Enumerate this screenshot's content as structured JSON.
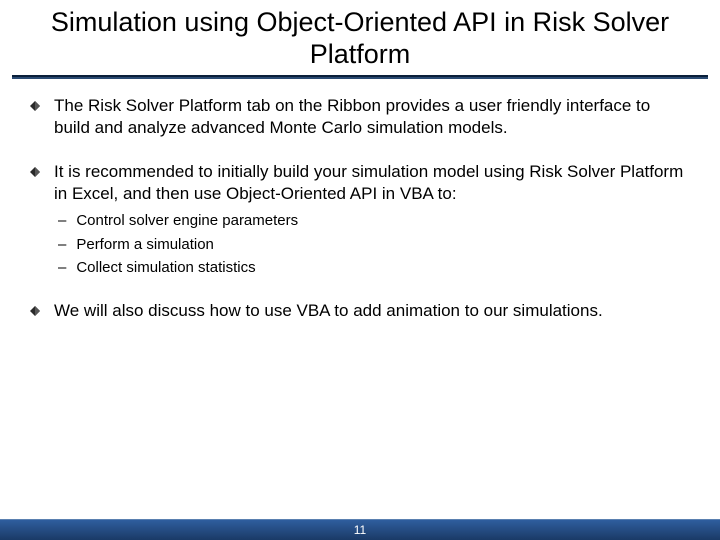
{
  "title": "Simulation using Object-Oriented API in Risk Solver Platform",
  "bullets": [
    {
      "text": "The Risk Solver Platform tab on the Ribbon provides a user friendly interface to build and analyze advanced Monte Carlo simulation models.",
      "subs": []
    },
    {
      "text": "It is recommended to initially build your simulation model using Risk Solver Platform in Excel, and then use Object-Oriented API in VBA to:",
      "subs": [
        "Control solver engine parameters",
        "Perform a simulation",
        "Collect simulation statistics"
      ]
    },
    {
      "text": "We will also discuss how to use VBA to add animation to our simulations.",
      "subs": []
    }
  ],
  "page_number": "11"
}
